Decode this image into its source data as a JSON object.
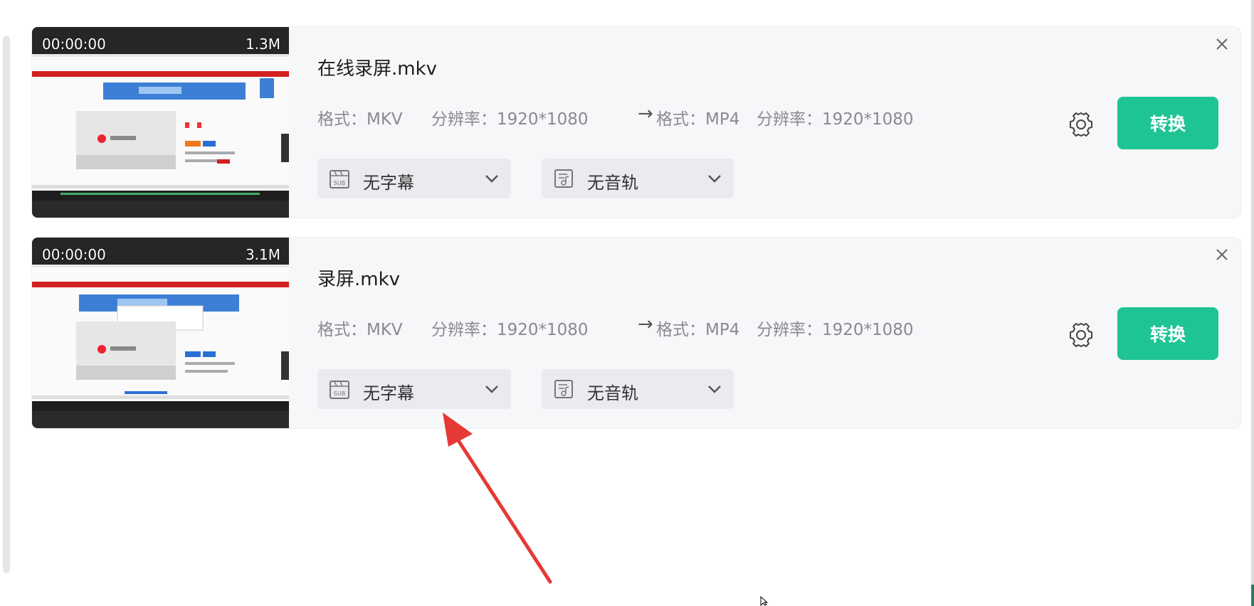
{
  "files": [
    {
      "name": "在线录屏.mkv",
      "duration": "00:00:00",
      "size": "1.3M",
      "source_format": "格式：MKV",
      "source_resolution": "分辨率：1920*1080",
      "arrow": "→",
      "target_format": "格式：MP4",
      "target_resolution": "分辨率：1920*1080",
      "subtitle_select": "无字幕",
      "audio_select": "无音轨",
      "convert_label": "转换"
    },
    {
      "name": "录屏.mkv",
      "duration": "00:00:00",
      "size": "3.1M",
      "source_format": "格式：MKV",
      "source_resolution": "分辨率：1920*1080",
      "arrow": "→",
      "target_format": "格式：MP4",
      "target_resolution": "分辨率：1920*1080",
      "subtitle_select": "无字幕",
      "audio_select": "无音轨",
      "convert_label": "转换"
    }
  ],
  "icons": {
    "close": "close-icon",
    "settings": "gear-icon",
    "subtitle": "subtitle-icon",
    "audio": "audio-track-icon",
    "chevron": "chevron-down-icon"
  },
  "colors": {
    "accent": "#1fc494",
    "card_bg": "#f6f7f9",
    "annotation_arrow": "#e53935"
  }
}
